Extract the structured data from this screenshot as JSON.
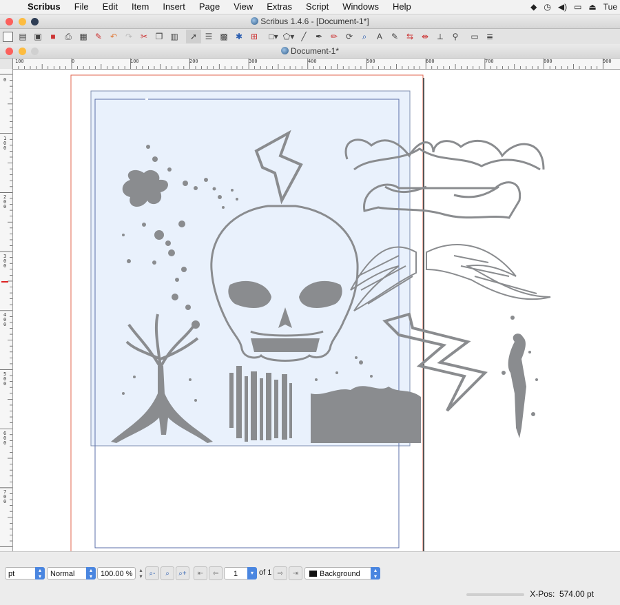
{
  "menubar": {
    "app": "Scribus",
    "items": [
      "File",
      "Edit",
      "Item",
      "Insert",
      "Page",
      "View",
      "Extras",
      "Script",
      "Windows",
      "Help"
    ],
    "clock": "Tue"
  },
  "window": {
    "title": "Scribus 1.4.6 - [Document-1*]"
  },
  "document": {
    "title": "Document-1*"
  },
  "ruler": {
    "h_labels": [
      "100",
      "0",
      "100",
      "200",
      "300",
      "400",
      "500",
      "600",
      "700",
      "800",
      "900"
    ],
    "v_labels": [
      "0",
      "100",
      "200",
      "300",
      "400",
      "500",
      "600",
      "700"
    ]
  },
  "bottom": {
    "unit": "pt",
    "mode": "Normal",
    "zoom": "100.00 %",
    "page_current": "1",
    "page_of": "of 1",
    "layer": "Background",
    "xpos_label": "X-Pos:",
    "xpos_value": "574.00 pt"
  },
  "colors": {
    "page_border": "#e0664c",
    "margin_guide": "#5b6fa8",
    "selection_fill": "#e9f1fc",
    "artwork": "#8a8c8f",
    "accent": "#4a86e0"
  }
}
